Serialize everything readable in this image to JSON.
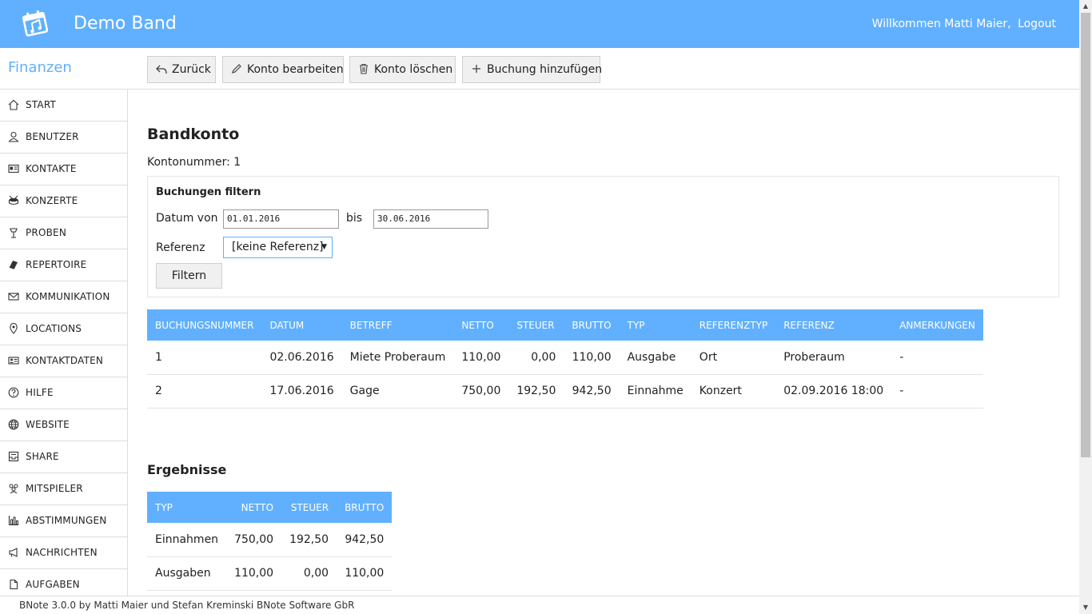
{
  "header": {
    "app_title": "Demo Band",
    "welcome": "Willkommen Matti Maier,",
    "logout": "Logout",
    "color": "#61b0ff"
  },
  "section_title": "Finanzen",
  "toolbar": {
    "back": "Zurück",
    "edit_account": "Konto bearbeiten",
    "delete_account": "Konto löschen",
    "add_booking": "Buchung hinzufügen"
  },
  "sidebar": {
    "items": [
      {
        "label": "START",
        "icon": "home-icon"
      },
      {
        "label": "BENUTZER",
        "icon": "user-icon"
      },
      {
        "label": "KONTAKTE",
        "icon": "id-card-icon"
      },
      {
        "label": "KONZERTE",
        "icon": "drum-icon"
      },
      {
        "label": "PROBEN",
        "icon": "music-stand-icon"
      },
      {
        "label": "REPERTOIRE",
        "icon": "book-icon"
      },
      {
        "label": "KOMMUNIKATION",
        "icon": "envelope-icon"
      },
      {
        "label": "LOCATIONS",
        "icon": "map-pin-icon"
      },
      {
        "label": "KONTAKTDATEN",
        "icon": "contact-card-icon"
      },
      {
        "label": "HILFE",
        "icon": "help-icon"
      },
      {
        "label": "WEBSITE",
        "icon": "globe-icon"
      },
      {
        "label": "SHARE",
        "icon": "inbox-icon"
      },
      {
        "label": "MITSPIELER",
        "icon": "group-icon"
      },
      {
        "label": "ABSTIMMUNGEN",
        "icon": "bar-chart-icon"
      },
      {
        "label": "NACHRICHTEN",
        "icon": "megaphone-icon"
      },
      {
        "label": "AUFGABEN",
        "icon": "document-icon"
      }
    ]
  },
  "main": {
    "title": "Bandkonto",
    "account_number": "Kontonummer: 1",
    "filter": {
      "title": "Buchungen filtern",
      "date_from_label": "Datum von",
      "date_from": "01.01.2016",
      "date_to_label": "bis",
      "date_to": "30.06.2016",
      "reference_label": "Referenz",
      "reference_value": "[keine Referenz]",
      "button": "Filtern"
    },
    "bookings": {
      "headers": [
        "BUCHUNGSNUMMER",
        "DATUM",
        "BETREFF",
        "NETTO",
        "STEUER",
        "BRUTTO",
        "TYP",
        "REFERENZTYP",
        "REFERENZ",
        "ANMERKUNGEN"
      ],
      "rows": [
        [
          "1",
          "02.06.2016",
          "Miete Proberaum",
          "110,00",
          "0,00",
          "110,00",
          "Ausgabe",
          "Ort",
          "Proberaum",
          "-"
        ],
        [
          "2",
          "17.06.2016",
          "Gage",
          "750,00",
          "192,50",
          "942,50",
          "Einnahme",
          "Konzert",
          "02.09.2016 18:00",
          "-"
        ]
      ]
    },
    "results": {
      "title": "Ergebnisse",
      "headers": [
        "TYP",
        "NETTO",
        "STEUER",
        "BRUTTO"
      ],
      "rows": [
        [
          "Einnahmen",
          "750,00",
          "192,50",
          "942,50"
        ],
        [
          "Ausgaben",
          "110,00",
          "0,00",
          "110,00"
        ]
      ]
    }
  },
  "footer": "BNote 3.0.0 by Matti Maier und Stefan Kreminski BNote Software GbR"
}
